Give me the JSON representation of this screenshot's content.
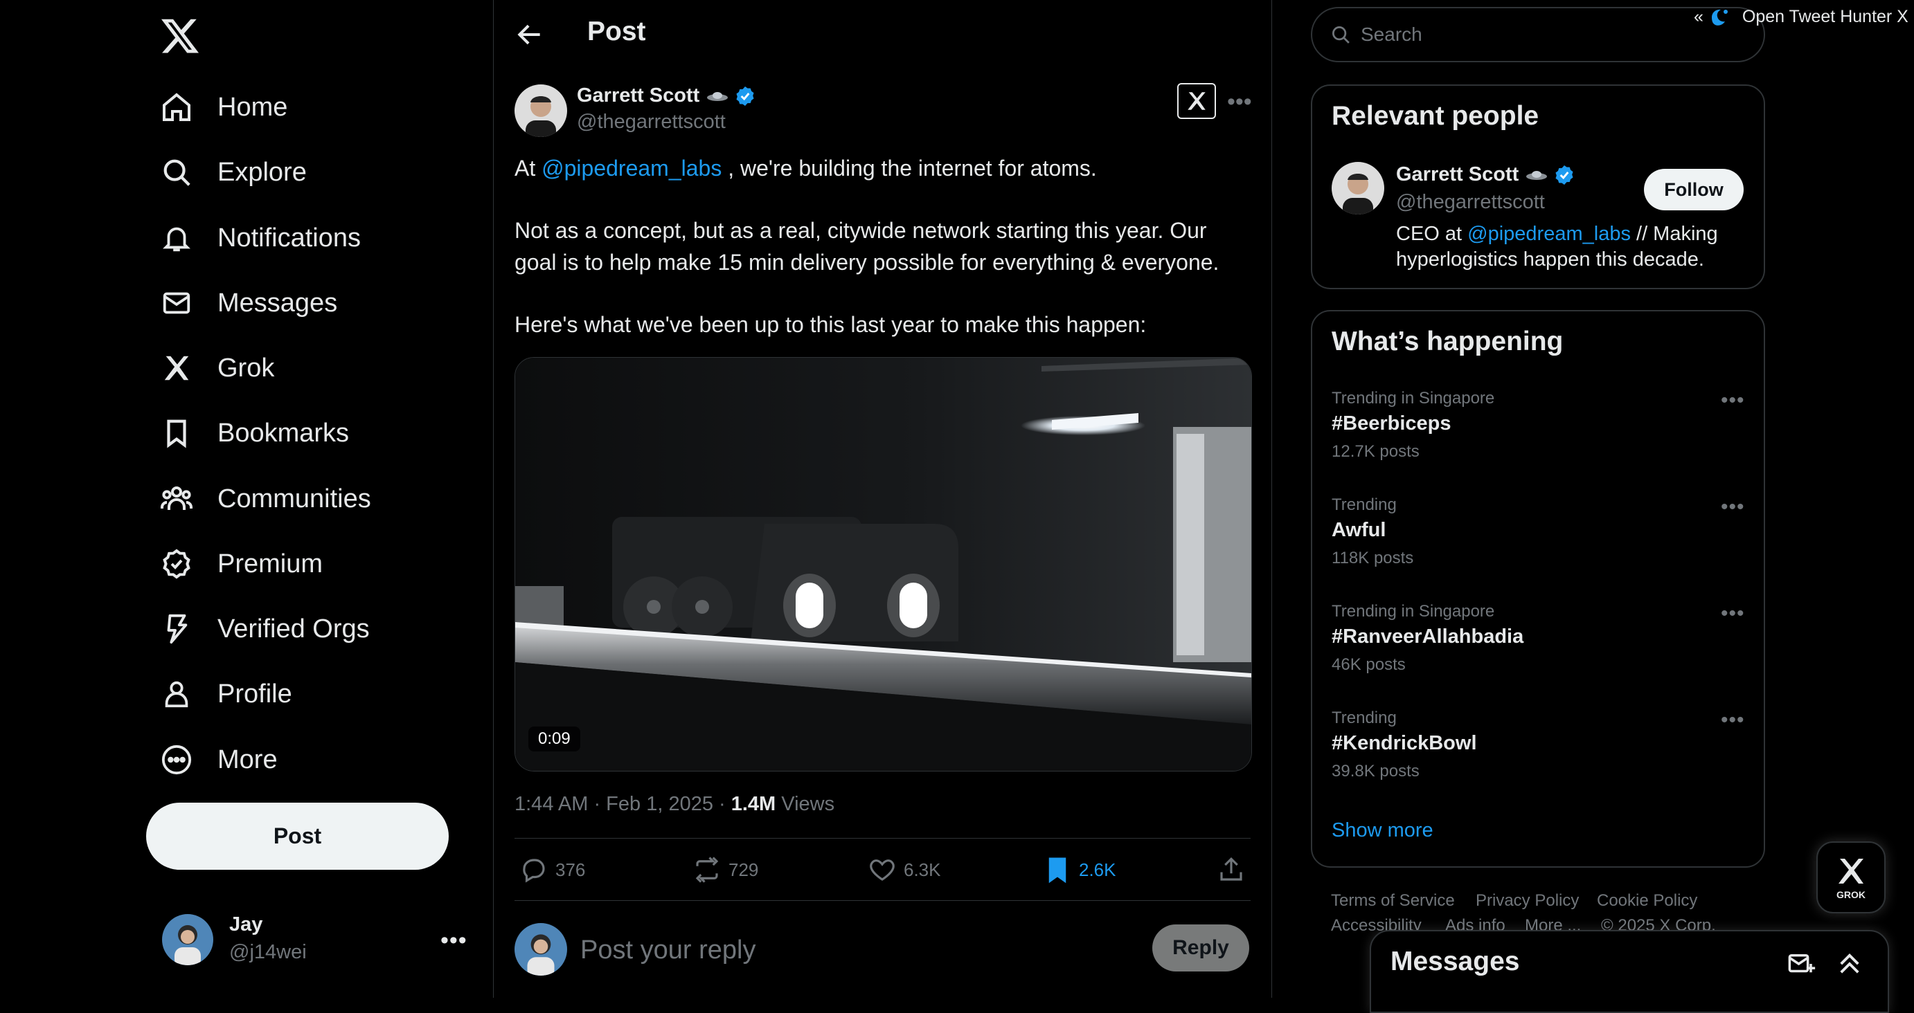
{
  "nav": {
    "items": [
      {
        "label": "Home",
        "icon": "home-icon"
      },
      {
        "label": "Explore",
        "icon": "search-icon"
      },
      {
        "label": "Notifications",
        "icon": "bell-icon"
      },
      {
        "label": "Messages",
        "icon": "envelope-icon"
      },
      {
        "label": "Grok",
        "icon": "grok-icon"
      },
      {
        "label": "Bookmarks",
        "icon": "bookmark-icon"
      },
      {
        "label": "Communities",
        "icon": "people-icon"
      },
      {
        "label": "Premium",
        "icon": "verified-badge-icon"
      },
      {
        "label": "Verified Orgs",
        "icon": "lightning-icon"
      },
      {
        "label": "Profile",
        "icon": "person-icon"
      },
      {
        "label": "More",
        "icon": "more-circle-icon"
      }
    ],
    "post_label": "Post",
    "account": {
      "name": "Jay",
      "handle": "@j14wei"
    }
  },
  "main": {
    "title": "Post",
    "author": {
      "name": "Garrett Scott",
      "handle": "@thegarrettscott"
    },
    "text": {
      "p1_before": "At ",
      "p1_mention": "@pipedream_labs",
      "p1_after": " , we're building the internet for atoms.",
      "p2": "Not as a concept, but as a real, citywide network starting this year. Our goal is to help make 15 min delivery possible for everything & everyone.",
      "p3": "Here's what we've been up to this last year to make this happen:"
    },
    "video_duration": "0:09",
    "meta": {
      "time": "1:44 AM · Feb 1, 2025 · ",
      "views": "1.4M",
      "views_label": " Views"
    },
    "actions": {
      "replies": "376",
      "reposts": "729",
      "likes": "6.3K",
      "bookmarks": "2.6K"
    },
    "reply": {
      "placeholder": "Post your reply",
      "button": "Reply"
    }
  },
  "right": {
    "search_placeholder": "Search",
    "extension_label": "Open Tweet Hunter X",
    "extension_prefix": "«",
    "relevant": {
      "title": "Relevant people",
      "name": "Garrett Scott",
      "handle": "@thegarrettscott",
      "follow": "Follow",
      "bio_before": "CEO at ",
      "bio_mention": "@pipedream_labs",
      "bio_after": " // Making hyperlogistics happen this decade."
    },
    "happening": {
      "title": "What’s happening",
      "trends": [
        {
          "context": "Trending in Singapore",
          "name": "#Beerbiceps",
          "count": "12.7K posts"
        },
        {
          "context": "Trending",
          "name": "Awful",
          "count": "118K posts"
        },
        {
          "context": "Trending in Singapore",
          "name": "#RanveerAllahbadia",
          "count": "46K posts"
        },
        {
          "context": "Trending",
          "name": "#KendrickBowl",
          "count": "39.8K posts"
        }
      ],
      "show_more": "Show more"
    },
    "footer": {
      "terms": "Terms of Service",
      "privacy": "Privacy Policy",
      "cookie": "Cookie Policy",
      "accessibility": "Accessibility",
      "ads": "Ads info",
      "more": "More ...",
      "copyright": "© 2025 X Corp."
    },
    "grok_label": "GROK",
    "messages_title": "Messages"
  },
  "colors": {
    "accent": "#1d9bf0",
    "text": "#e7e9ea",
    "muted": "#71767b",
    "border": "#2f3336"
  }
}
